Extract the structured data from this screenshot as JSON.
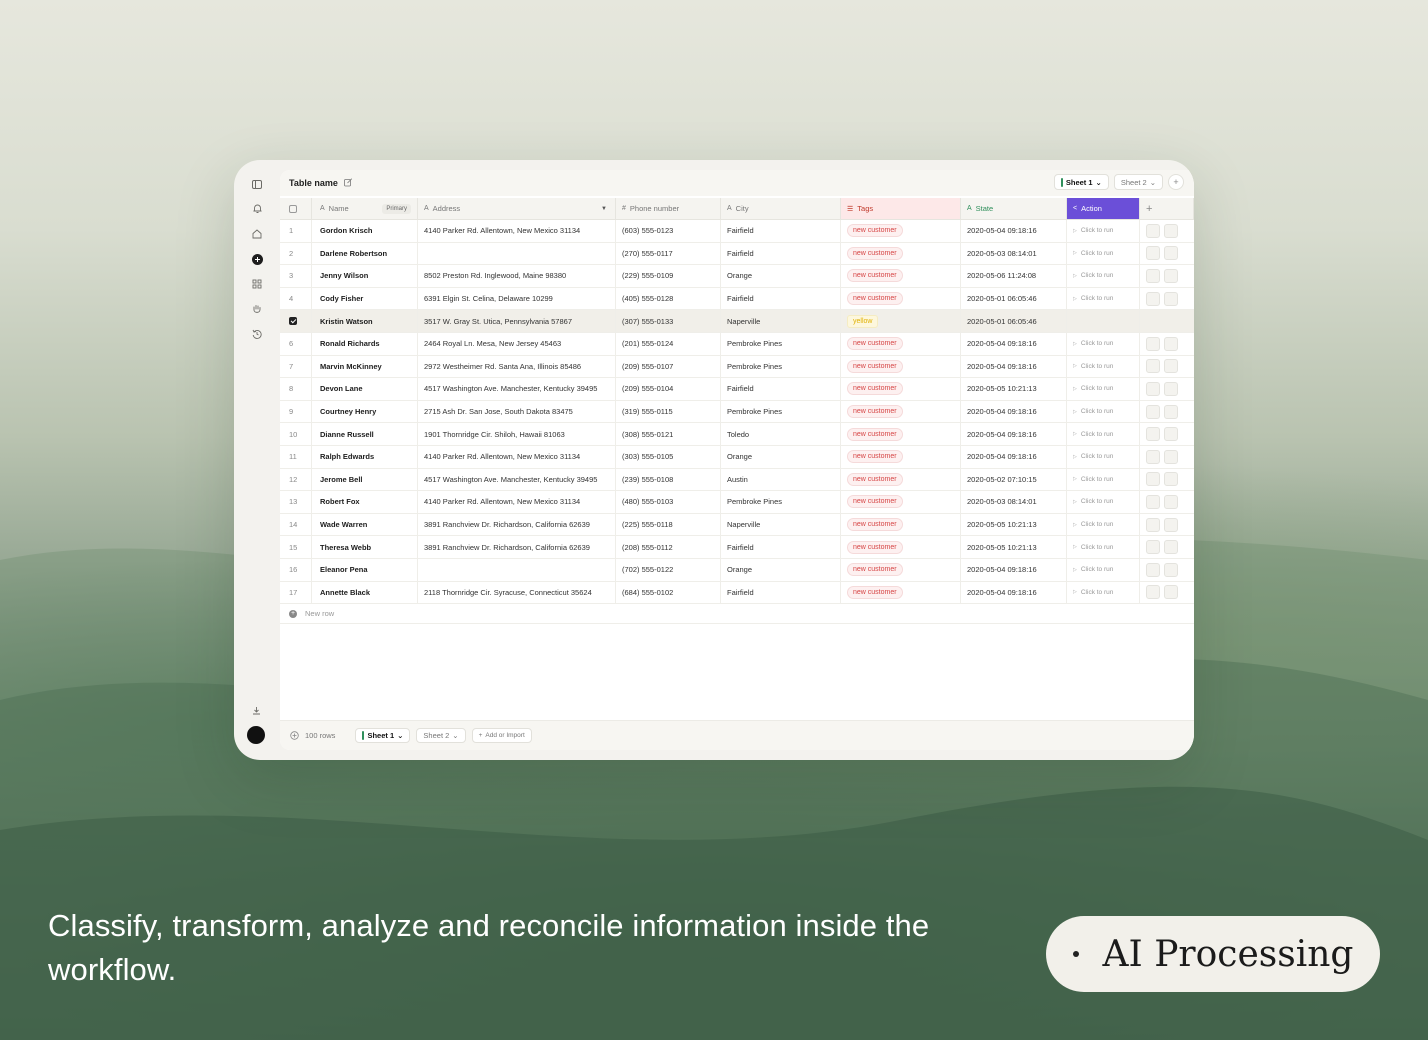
{
  "table": {
    "title": "Table name",
    "top_tabs": [
      {
        "label": "Sheet 1"
      },
      {
        "label": "Sheet 2"
      }
    ],
    "columns": {
      "name": "Name",
      "primary_badge": "Primary",
      "address": "Address",
      "phone": "Phone number",
      "city": "City",
      "tags": "Tags",
      "state": "State",
      "action": "Action"
    },
    "run_label": "Click to run",
    "new_row": "New row",
    "rows": [
      {
        "num": "1",
        "name": "Gordon Krisch",
        "address": "4140 Parker Rd. Allentown, New Mexico 31134",
        "phone": "(603) 555-0123",
        "city": "Fairfield",
        "tag": "new customer",
        "state": "2020-05-04 09:18:16"
      },
      {
        "num": "2",
        "name": "Darlene Robertson",
        "address": "",
        "phone": "(270) 555-0117",
        "city": "Fairfield",
        "tag": "new customer",
        "state": "2020-05-03 08:14:01"
      },
      {
        "num": "3",
        "name": "Jenny Wilson",
        "address": "8502 Preston Rd. Inglewood, Maine 98380",
        "phone": "(229) 555-0109",
        "city": "Orange",
        "tag": "new customer",
        "state": "2020-05-06 11:24:08"
      },
      {
        "num": "4",
        "name": "Cody Fisher",
        "address": "6391 Elgin St. Celina, Delaware 10299",
        "phone": "(405) 555-0128",
        "city": "Fairfield",
        "tag": "new customer",
        "state": "2020-05-01 06:05:46"
      },
      {
        "num": "",
        "name": "Kristin Watson",
        "address": "3517 W. Gray St. Utica, Pennsylvania 57867",
        "phone": "(307) 555-0133",
        "city": "Naperville",
        "tag": "yellow",
        "state": "2020-05-01 06:05:46",
        "selected": true
      },
      {
        "num": "6",
        "name": "Ronald Richards",
        "address": "2464 Royal Ln. Mesa, New Jersey 45463",
        "phone": "(201) 555-0124",
        "city": "Pembroke Pines",
        "tag": "new customer",
        "state": "2020-05-04 09:18:16"
      },
      {
        "num": "7",
        "name": "Marvin McKinney",
        "address": "2972 Westheimer Rd. Santa Ana, Illinois 85486",
        "phone": "(209) 555-0107",
        "city": "Pembroke Pines",
        "tag": "new customer",
        "state": "2020-05-04 09:18:16"
      },
      {
        "num": "8",
        "name": "Devon Lane",
        "address": "4517 Washington Ave. Manchester, Kentucky 39495",
        "phone": "(209) 555-0104",
        "city": "Fairfield",
        "tag": "new customer",
        "state": "2020-05-05 10:21:13"
      },
      {
        "num": "9",
        "name": "Courtney Henry",
        "address": "2715 Ash Dr. San Jose, South Dakota 83475",
        "phone": "(319) 555-0115",
        "city": "Pembroke Pines",
        "tag": "new customer",
        "state": "2020-05-04 09:18:16"
      },
      {
        "num": "10",
        "name": "Dianne Russell",
        "address": "1901 Thornridge Cir. Shiloh, Hawaii 81063",
        "phone": "(308) 555-0121",
        "city": "Toledo",
        "tag": "new customer",
        "state": "2020-05-04 09:18:16"
      },
      {
        "num": "11",
        "name": "Ralph Edwards",
        "address": "4140 Parker Rd. Allentown, New Mexico 31134",
        "phone": "(303) 555-0105",
        "city": "Orange",
        "tag": "new customer",
        "state": "2020-05-04 09:18:16"
      },
      {
        "num": "12",
        "name": "Jerome Bell",
        "address": "4517 Washington Ave. Manchester, Kentucky 39495",
        "phone": "(239) 555-0108",
        "city": "Austin",
        "tag": "new customer",
        "state": "2020-05-02 07:10:15"
      },
      {
        "num": "13",
        "name": "Robert Fox",
        "address": "4140 Parker Rd. Allentown, New Mexico 31134",
        "phone": "(480) 555-0103",
        "city": "Pembroke Pines",
        "tag": "new customer",
        "state": "2020-05-03 08:14:01"
      },
      {
        "num": "14",
        "name": "Wade Warren",
        "address": "3891 Ranchview Dr. Richardson, California 62639",
        "phone": "(225) 555-0118",
        "city": "Naperville",
        "tag": "new customer",
        "state": "2020-05-05 10:21:13"
      },
      {
        "num": "15",
        "name": "Theresa Webb",
        "address": "3891 Ranchview Dr. Richardson, California 62639",
        "phone": "(208) 555-0112",
        "city": "Fairfield",
        "tag": "new customer",
        "state": "2020-05-05 10:21:13"
      },
      {
        "num": "16",
        "name": "Eleanor Pena",
        "address": "",
        "phone": "(702) 555-0122",
        "city": "Orange",
        "tag": "new customer",
        "state": "2020-05-04 09:18:16"
      },
      {
        "num": "17",
        "name": "Annette Black",
        "address": "2118 Thornridge Cir. Syracuse, Connecticut 35624",
        "phone": "(684) 555-0102",
        "city": "Fairfield",
        "tag": "new customer",
        "state": "2020-05-04 09:18:16"
      }
    ]
  },
  "footer": {
    "rows_count": "100 rows",
    "tabs": [
      {
        "label": "Sheet 1"
      },
      {
        "label": "Sheet 2"
      }
    ],
    "add_import": "Add or Import"
  },
  "caption": "Classify, transform, analyze and reconcile information inside the workflow.",
  "pill_label": "AI Processing",
  "colors": {
    "action": "#6b4fd8",
    "tag": "#d64545",
    "state": "#2f8f5b"
  }
}
